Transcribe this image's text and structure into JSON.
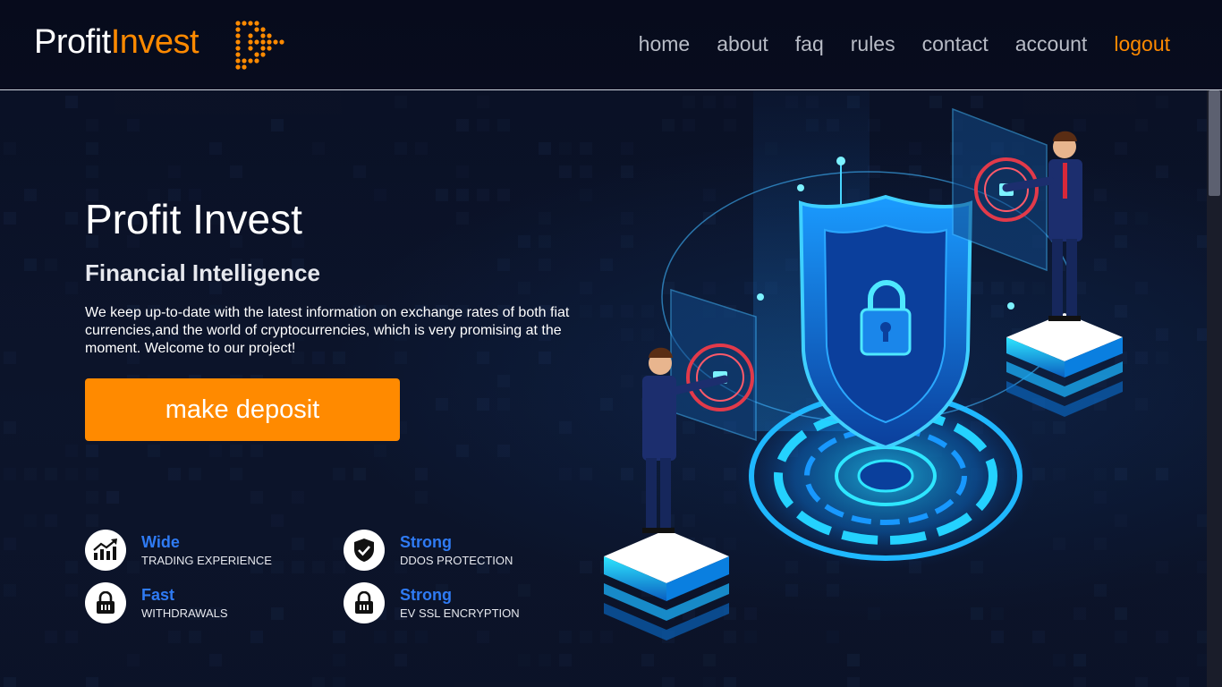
{
  "logo": {
    "part1": "Profit",
    "part2": "Invest"
  },
  "nav": {
    "home": "home",
    "about": "about",
    "faq": "faq",
    "rules": "rules",
    "contact": "contact",
    "account": "account",
    "logout": "logout"
  },
  "hero": {
    "title": "Profit Invest",
    "subtitle": "Financial Intelligence",
    "description": "We keep up-to-date with the latest information on exchange rates of both fiat currencies,and the world of cryptocurrencies, which is very promising at the moment. Welcome to our project!",
    "cta_label": "make deposit"
  },
  "features": [
    {
      "title": "Wide",
      "caption": "TRADING EXPERIENCE",
      "icon": "chart-up-icon"
    },
    {
      "title": "Strong",
      "caption": "DDOS PROTECTION",
      "icon": "shield-check-icon"
    },
    {
      "title": "Fast",
      "caption": "WITHDRAWALS",
      "icon": "lock-icon"
    },
    {
      "title": "Strong",
      "caption": "EV SSL ENCRYPTION",
      "icon": "lock-icon"
    }
  ],
  "colors": {
    "accent": "#ff8a00",
    "feature_title": "#2f7bf4",
    "background": "#080c1e"
  }
}
